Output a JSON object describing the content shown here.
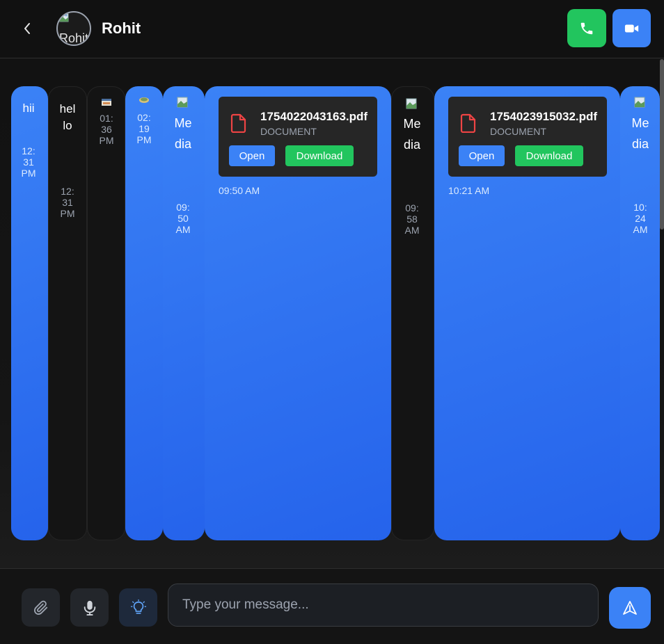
{
  "header": {
    "back_icon": "chevron-left-icon",
    "avatar_alt": "Rohit",
    "contact_name": "Rohit",
    "call_icon": "phone-icon",
    "video_icon": "video-icon"
  },
  "colors": {
    "accent_blue": "#3b82f6",
    "accent_green": "#22c55e",
    "pdf_red": "#ef4444"
  },
  "messages": [
    {
      "kind": "text",
      "side": "sent",
      "text": "hii",
      "time": "12:31 PM"
    },
    {
      "kind": "text",
      "side": "received",
      "text": "hello",
      "time": "12:31 PM"
    },
    {
      "kind": "image",
      "side": "received",
      "time": "01:36 PM"
    },
    {
      "kind": "image",
      "side": "sent",
      "time": "02:19 PM"
    },
    {
      "kind": "media",
      "side": "sent",
      "text": "Media",
      "time": "09:50 AM"
    },
    {
      "kind": "document",
      "side": "sent",
      "file_name": "1754022043163.pdf",
      "file_type": "DOCUMENT",
      "open_label": "Open",
      "download_label": "Download",
      "time": "09:50 AM"
    },
    {
      "kind": "media",
      "side": "received",
      "text": "Media",
      "time": "09:58 AM"
    },
    {
      "kind": "document",
      "side": "sent",
      "file_name": "1754023915032.pdf",
      "file_type": "DOCUMENT",
      "open_label": "Open",
      "download_label": "Download",
      "time": "10:21 AM"
    },
    {
      "kind": "media",
      "side": "sent",
      "text": "Media",
      "time": "10:24 AM"
    }
  ],
  "composer": {
    "attach_icon": "paperclip-icon",
    "mic_icon": "microphone-icon",
    "idea_icon": "lightbulb-icon",
    "placeholder": "Type your message...",
    "send_icon": "send-icon"
  }
}
